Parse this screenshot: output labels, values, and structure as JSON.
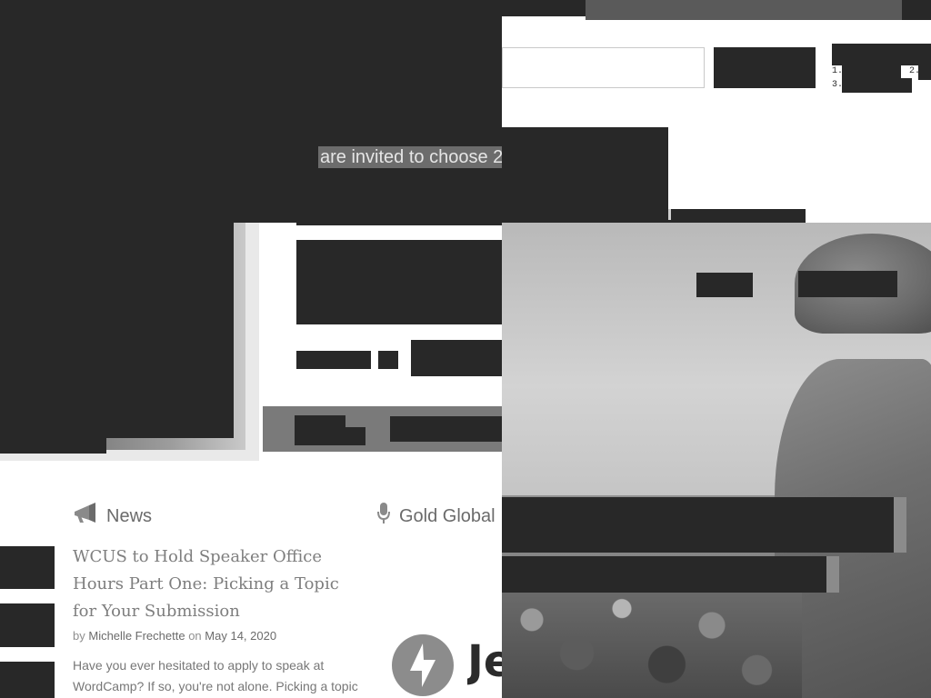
{
  "redacted_banner": {
    "invite_text": "are invited to choose 2"
  },
  "top_right_list": {
    "item1": "1.",
    "item2": "2.",
    "item3": "3."
  },
  "news_section": {
    "heading": "News",
    "icon": "megaphone-icon",
    "post": {
      "title": "WCUS to Hold Speaker Office Hours Part One: Picking a Topic for Your Submission",
      "by_label": "by",
      "author": "Michelle Frechette",
      "on_label": "on",
      "date": "May 14, 2020",
      "excerpt": "Have you ever hesitated to apply to speak at WordCamp? If so, you're not alone. Picking a topic"
    }
  },
  "sponsors_section": {
    "heading": "Gold Global",
    "icon": "microphone-icon",
    "logo_text": "Je"
  },
  "hero_image": {
    "description_icon": "farmer-photo"
  }
}
